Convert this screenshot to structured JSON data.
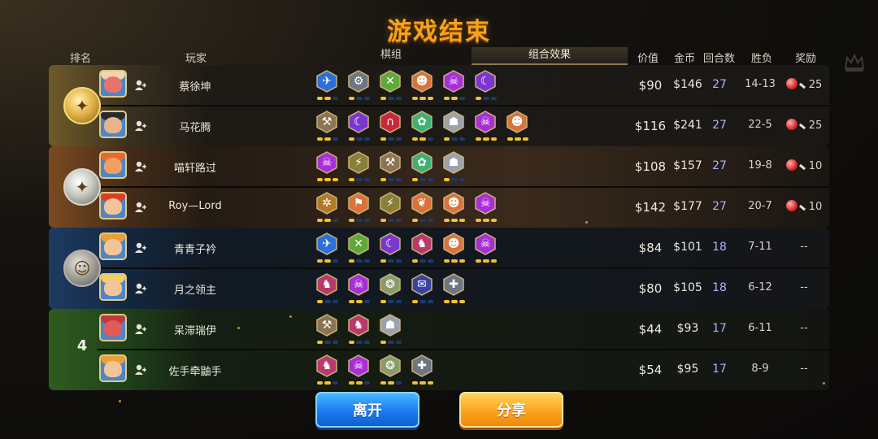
{
  "title": "游戏结束",
  "headers": {
    "rank": "排名",
    "player": "玩家",
    "units_tab": "棋组",
    "synergy_tab": "组合效果",
    "value": "价值",
    "gold": "金币",
    "rounds": "回合数",
    "win_loss": "胜负",
    "reward": "奖励"
  },
  "rank_label_4": "4",
  "colors": {
    "accent": "#f6a21c",
    "rounds": "#a9b4ff",
    "unit_bar_on": "#f2c12a",
    "unit_bar_off": "#1b3a6b"
  },
  "players": [
    {
      "name": "蔡徐坤",
      "value": "$90",
      "gold": "$146",
      "rounds": "27",
      "wl": "14-13",
      "reward": "25",
      "units": [
        {
          "color": "#2d6fd8",
          "sym": "✈",
          "icon": "feather-icon",
          "stars": 2
        },
        {
          "color": "#6e7684",
          "sym": "⚙",
          "icon": "dots-icon",
          "stars": 1
        },
        {
          "color": "#5fa83a",
          "sym": "✕",
          "icon": "crossbow-icon",
          "stars": 1
        },
        {
          "color": "#d9733a",
          "sym": "☻",
          "icon": "viking-icon",
          "stars": 3
        },
        {
          "color": "#a82fd6",
          "sym": "☠",
          "icon": "demon-icon",
          "stars": 2
        },
        {
          "color": "#7c36d0",
          "sym": "☾",
          "icon": "moon-icon",
          "stars": 1
        }
      ]
    },
    {
      "name": "马花腾",
      "value": "$116",
      "gold": "$241",
      "rounds": "27",
      "wl": "22-5",
      "reward": "25",
      "units": [
        {
          "color": "#8a7452",
          "sym": "⚒",
          "icon": "axe-icon",
          "stars": 2
        },
        {
          "color": "#7c36d0",
          "sym": "☾",
          "icon": "moon-icon",
          "stars": 1
        },
        {
          "color": "#c62a3a",
          "sym": "∩",
          "icon": "arch-icon",
          "stars": 1
        },
        {
          "color": "#3fb072",
          "sym": "✿",
          "icon": "paw-icon",
          "stars": 2
        },
        {
          "color": "#9aa2ad",
          "sym": "☗",
          "icon": "helmet-icon",
          "stars": 1
        },
        {
          "color": "#a82fd6",
          "sym": "☠",
          "icon": "demon-icon",
          "stars": 3
        },
        {
          "color": "#d9733a",
          "sym": "☻",
          "icon": "viking-icon",
          "stars": 3
        }
      ]
    },
    {
      "name": "喵轩路过",
      "value": "$108",
      "gold": "$157",
      "rounds": "27",
      "wl": "19-8",
      "reward": "10",
      "units": [
        {
          "color": "#a82fd6",
          "sym": "☠",
          "icon": "demon-icon",
          "stars": 3
        },
        {
          "color": "#8a7f3a",
          "sym": "⚡",
          "icon": "lightning-icon",
          "stars": 1
        },
        {
          "color": "#8a7452",
          "sym": "⚒",
          "icon": "axe-icon",
          "stars": 1
        },
        {
          "color": "#3fb072",
          "sym": "✿",
          "icon": "paw-icon",
          "stars": 1
        },
        {
          "color": "#9aa2ad",
          "sym": "☗",
          "icon": "helmet-icon",
          "stars": 1
        }
      ]
    },
    {
      "name": "Roy—Lord",
      "value": "$142",
      "gold": "$177",
      "rounds": "27",
      "wl": "20-7",
      "reward": "10",
      "units": [
        {
          "color": "#b07a2a",
          "sym": "✲",
          "icon": "gear-icon",
          "stars": 2
        },
        {
          "color": "#d9733a",
          "sym": "⚑",
          "icon": "mushroom-icon",
          "stars": 1
        },
        {
          "color": "#8a7f3a",
          "sym": "⚡",
          "icon": "lightning-icon",
          "stars": 1
        },
        {
          "color": "#d9733a",
          "sym": "❦",
          "icon": "leaf-icon",
          "stars": 1
        },
        {
          "color": "#d9733a",
          "sym": "☻",
          "icon": "viking-icon",
          "stars": 3
        },
        {
          "color": "#a82fd6",
          "sym": "☠",
          "icon": "demon-icon",
          "stars": 3
        }
      ]
    },
    {
      "name": "青青子衿",
      "value": "$84",
      "gold": "$101",
      "rounds": "18",
      "wl": "7-11",
      "reward": "--",
      "units": [
        {
          "color": "#2d6fd8",
          "sym": "✈",
          "icon": "feather-icon",
          "stars": 2
        },
        {
          "color": "#5fa83a",
          "sym": "✕",
          "icon": "crossbow-icon",
          "stars": 1
        },
        {
          "color": "#7c36d0",
          "sym": "☾",
          "icon": "moon-icon",
          "stars": 1
        },
        {
          "color": "#b83a6a",
          "sym": "♞",
          "icon": "knight-icon",
          "stars": 1
        },
        {
          "color": "#d9733a",
          "sym": "☻",
          "icon": "viking-icon",
          "stars": 3
        },
        {
          "color": "#a82fd6",
          "sym": "☠",
          "icon": "demon-icon",
          "stars": 3
        }
      ]
    },
    {
      "name": "月之领主",
      "value": "$80",
      "gold": "$105",
      "rounds": "18",
      "wl": "6-12",
      "reward": "--",
      "units": [
        {
          "color": "#b83a6a",
          "sym": "♞",
          "icon": "knight-icon",
          "stars": 1
        },
        {
          "color": "#a82fd6",
          "sym": "☠",
          "icon": "demon-icon",
          "stars": 2
        },
        {
          "color": "#8a9a6a",
          "sym": "❂",
          "icon": "shield-icon",
          "stars": 1
        },
        {
          "color": "#3a44a0",
          "sym": "✉",
          "icon": "mech-icon",
          "stars": 1
        },
        {
          "color": "#6e7684",
          "sym": "✚",
          "icon": "cross-icon",
          "stars": 3
        }
      ]
    },
    {
      "name": "呆滞瑞伊",
      "value": "$44",
      "gold": "$93",
      "rounds": "17",
      "wl": "6-11",
      "reward": "--",
      "units": [
        {
          "color": "#8a7452",
          "sym": "⚒",
          "icon": "axe-icon",
          "stars": 1
        },
        {
          "color": "#b83a6a",
          "sym": "♞",
          "icon": "knight-icon",
          "stars": 1
        },
        {
          "color": "#9aa2ad",
          "sym": "☗",
          "icon": "helmet-icon",
          "stars": 1
        }
      ]
    },
    {
      "name": "佐手牵鼬手",
      "value": "$54",
      "gold": "$95",
      "rounds": "17",
      "wl": "8-9",
      "reward": "--",
      "units": [
        {
          "color": "#b83a6a",
          "sym": "♞",
          "icon": "knight-icon",
          "stars": 2
        },
        {
          "color": "#a82fd6",
          "sym": "☠",
          "icon": "demon-icon",
          "stars": 2
        },
        {
          "color": "#8a9a6a",
          "sym": "❂",
          "icon": "shield-icon",
          "stars": 2
        },
        {
          "color": "#6e7684",
          "sym": "✚",
          "icon": "cross-icon",
          "stars": 3
        }
      ]
    }
  ],
  "buttons": {
    "leave": "离开",
    "share": "分享"
  }
}
